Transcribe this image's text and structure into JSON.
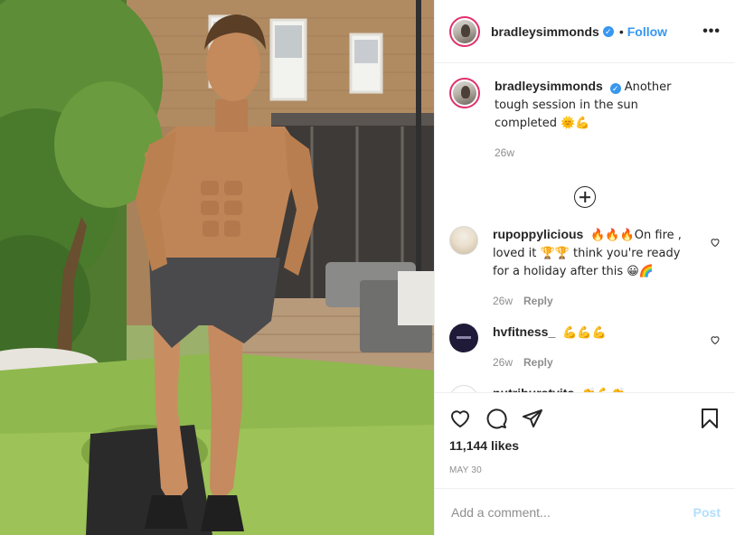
{
  "header": {
    "username": "bradleysimmonds",
    "separator": "•",
    "follow_label": "Follow",
    "more_label": "•••"
  },
  "caption": {
    "username": "bradleysimmonds",
    "text": "Another tough session in the sun completed 🌞💪",
    "age": "26w"
  },
  "comments": [
    {
      "username": "rupoppylicious",
      "text": "🔥🔥🔥On fire , loved it 🏆🏆 think you're ready for a holiday after this 😀🌈",
      "age": "26w",
      "reply_label": "Reply"
    },
    {
      "username": "hvfitness_",
      "text": "💪💪💪",
      "age": "26w",
      "reply_label": "Reply"
    },
    {
      "username": "nutriburstvits",
      "text": "👏💪👏",
      "avatar_letter": "n"
    }
  ],
  "actions": {
    "likes": "11,144 likes",
    "date": "MAY 30",
    "icons": [
      "heart-icon",
      "comment-icon",
      "share-icon",
      "bookmark-icon"
    ]
  },
  "comment_box": {
    "placeholder": "Add a comment...",
    "post_label": "Post"
  },
  "colors": {
    "accent": "#3897f0",
    "text": "#262626",
    "muted": "#8e8e8e",
    "post_disabled": "#b2dffc"
  }
}
